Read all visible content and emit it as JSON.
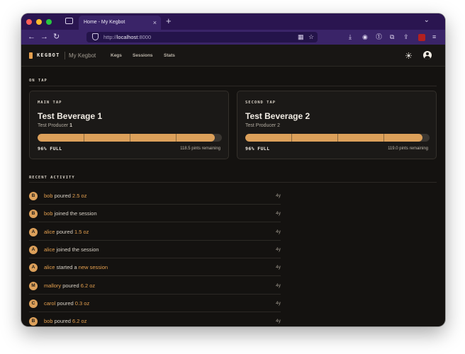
{
  "browser": {
    "tab_title": "Home - My Kegbot",
    "tab_close": "×",
    "new_tab": "+",
    "tab_list": "⌄",
    "back": "←",
    "forward": "→",
    "reload": "↻",
    "url_scheme": "http://",
    "url_host": "localhost",
    "url_port": ":8000"
  },
  "header": {
    "brand": "KEGBOT",
    "site_name": "My Kegbot",
    "nav": [
      "Kegs",
      "Sessions",
      "Stats"
    ]
  },
  "on_tap": {
    "title": "ON TAP",
    "taps": [
      {
        "tap_name": "MAIN TAP",
        "beverage": "Test Beverage 1",
        "producer_prefix": "Test Producer ",
        "producer_num": "1",
        "percent": 96,
        "fullness": "96% FULL",
        "remaining": "118.5 pints remaining"
      },
      {
        "tap_name": "SECOND TAP",
        "beverage": "Test Beverage 2",
        "producer_prefix": "Test Producer ",
        "producer_num": "2",
        "percent": 96,
        "fullness": "96% FULL",
        "remaining": "119.0 pints remaining"
      }
    ]
  },
  "activity": {
    "title": "RECENT ACTIVITY",
    "items": [
      {
        "initial": "B",
        "user": "bob",
        "action": " poured ",
        "detail": "2.5 oz",
        "age": "4y"
      },
      {
        "initial": "B",
        "user": "bob",
        "action": " joined the session",
        "detail": "",
        "age": "4y"
      },
      {
        "initial": "A",
        "user": "alice",
        "action": " poured ",
        "detail": "1.5 oz",
        "age": "4y"
      },
      {
        "initial": "A",
        "user": "alice",
        "action": " joined the session",
        "detail": "",
        "age": "4y"
      },
      {
        "initial": "A",
        "user": "alice",
        "action": " started a ",
        "detail": "new session",
        "age": "4y"
      },
      {
        "initial": "M",
        "user": "mallory",
        "action": " poured ",
        "detail": "6.2 oz",
        "age": "4y"
      },
      {
        "initial": "C",
        "user": "carol",
        "action": " poured ",
        "detail": "0.3 oz",
        "age": "4y"
      },
      {
        "initial": "B",
        "user": "bob",
        "action": " poured ",
        "detail": "6.2 oz",
        "age": "4y"
      }
    ]
  },
  "colors": {
    "accent": "#dca05a",
    "background": "#141210",
    "chrome": "#3a2468"
  },
  "icons": [
    "shield-icon",
    "grid-icon",
    "star-icon",
    "download-icon",
    "account-icon",
    "onepassword-icon",
    "extensions-icon",
    "share-icon",
    "ublock-icon",
    "menu-icon",
    "sun-icon",
    "user-icon"
  ]
}
